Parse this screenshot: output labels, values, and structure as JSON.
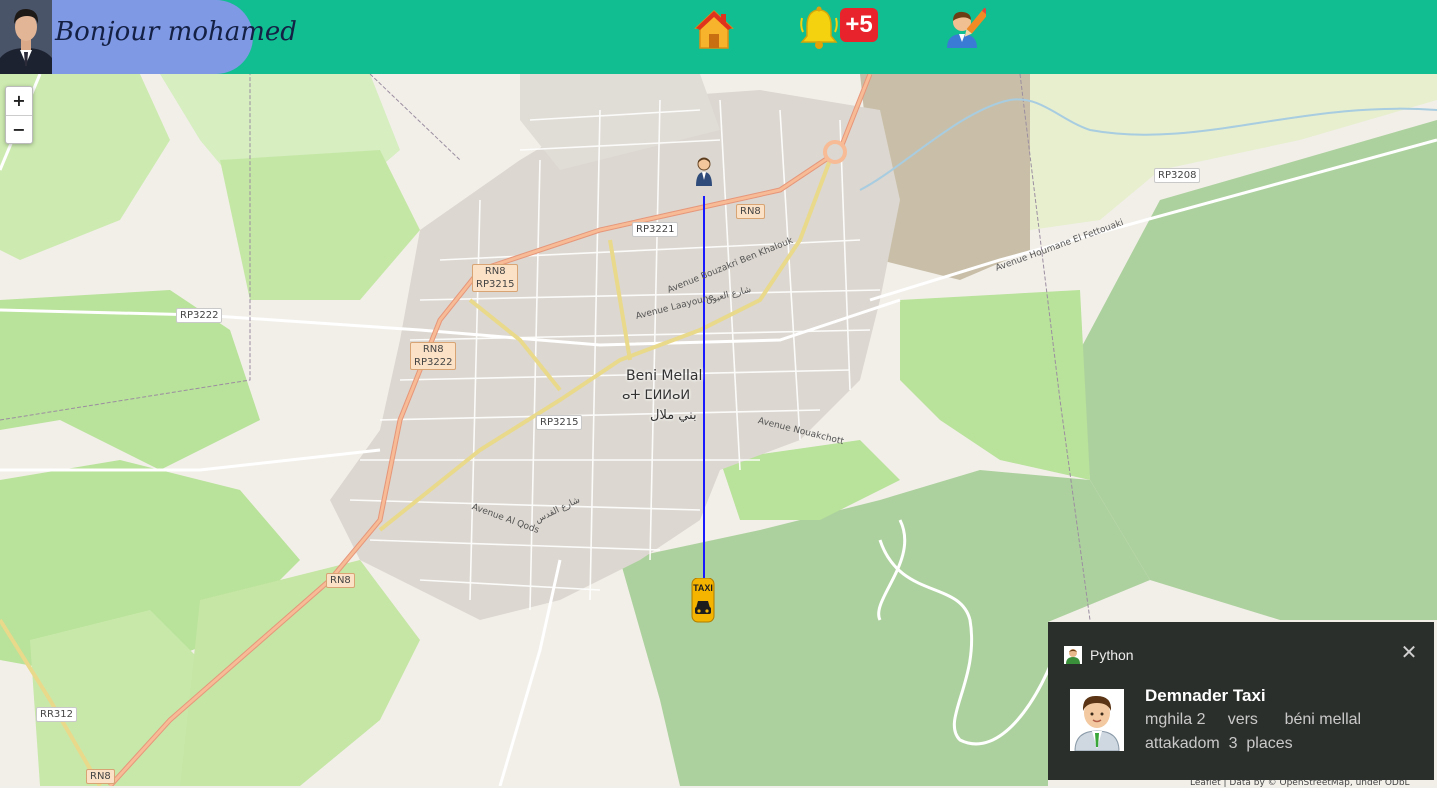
{
  "header": {
    "greeting": "Bonjour mohamed",
    "notification_badge": "+5",
    "nav_icons": [
      "home-icon",
      "bell-icon",
      "profile-edit-icon"
    ],
    "brand_color": "#10be91",
    "greeting_bg_color": "#7f99e5"
  },
  "map": {
    "zoom_in": "+",
    "zoom_out": "−",
    "city_name": "Beni Mellal",
    "city_name_tifinagh": "ⴰⵜ ⵎⵍⵍⴰⵍ",
    "city_name_arabic": "بني ملال",
    "road_labels": {
      "rn8_top": "RN8",
      "rp3221": "RP3221",
      "rn8_rp3215_a": "RN8",
      "rn8_rp3215_b": "RP3215",
      "rp3222": "RP3222",
      "rn8_rp3222_a": "RN8",
      "rn8_rp3222_b": "RP3222",
      "rp3215": "RP3215",
      "rn8_mid": "RN8",
      "rr312": "RR312",
      "rn8_bottom": "RN8",
      "rp3208": "RP3208"
    },
    "street_labels": {
      "bouzakri": "Avenue Bouzakri Ben Khalouk",
      "laayoune": "Avenue Laayoune",
      "laayoune_ar": "شارع العيون",
      "nouakchott": "Avenue Nouakchott",
      "alqods": "Avenue Al Qods",
      "alqods_ar": "شارع القدس",
      "houmane": "Avenue Houmane El Fettouaki"
    },
    "route_color": "#1a1aff",
    "markers": [
      "user-location-icon",
      "taxi-icon"
    ],
    "taxi_sign": "TAXI",
    "attribution": "Leaflet | Data by © OpenStreetMap, under ODbL"
  },
  "notification": {
    "app_name": "Python",
    "title": "Demnader Taxi",
    "line1": "mghila 2     vers      béni mellal",
    "line2": "attakadom  3  places",
    "close": "✕"
  }
}
